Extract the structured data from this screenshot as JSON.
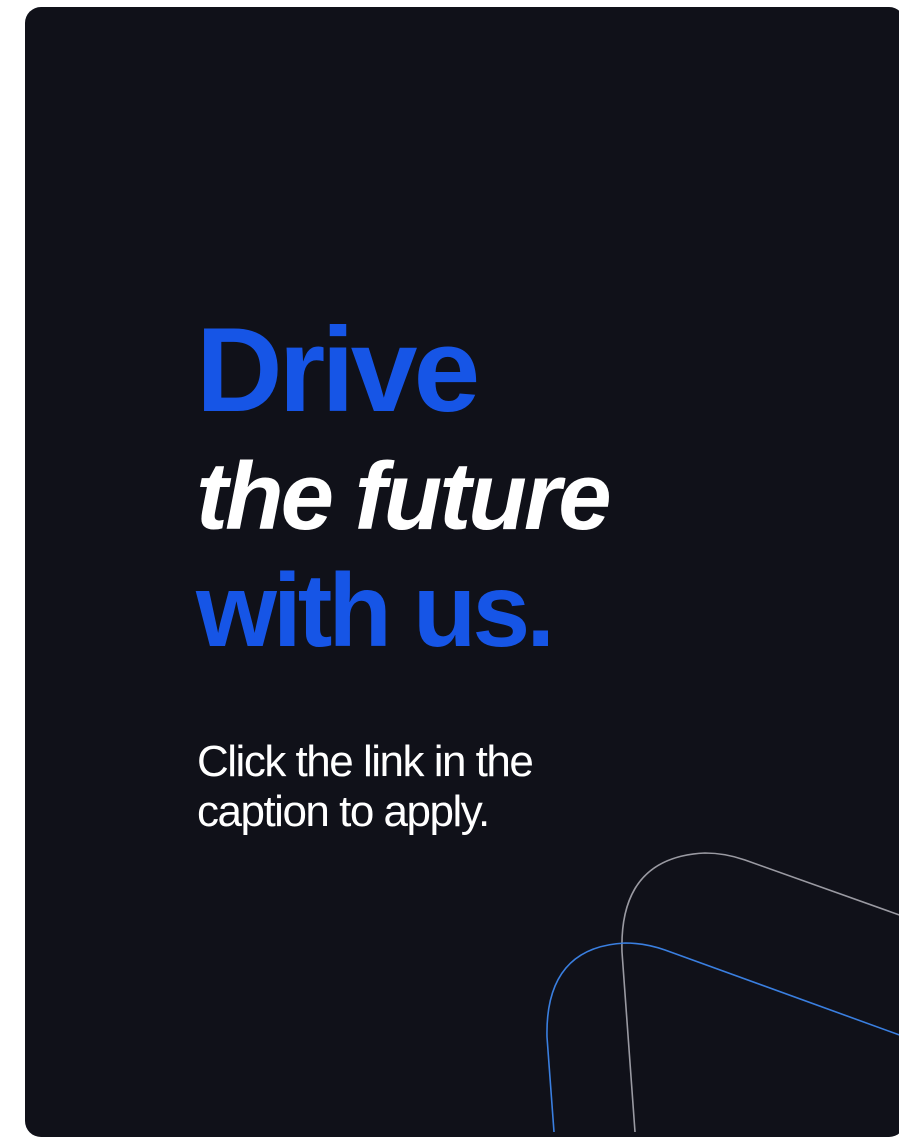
{
  "headline": {
    "line1": "Drive",
    "line2": "the future",
    "line3": "with us."
  },
  "subtitle": {
    "line1": "Click the link in the",
    "line2": "caption to apply."
  },
  "colors": {
    "background": "#101119",
    "accent": "#1655e6",
    "text": "#ffffff",
    "outline_gray": "#9a9aa2",
    "outline_blue": "#3a7fe0"
  }
}
